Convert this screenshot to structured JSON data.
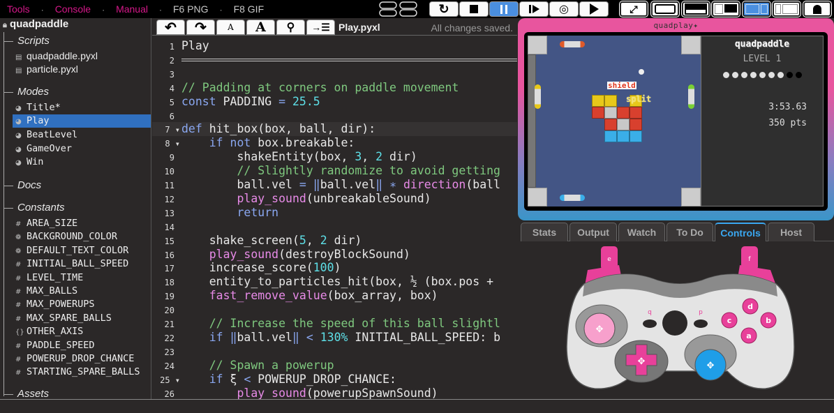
{
  "topbar": {
    "menu": [
      {
        "label": "Tools",
        "kind": "link"
      },
      {
        "label": "Console",
        "kind": "link"
      },
      {
        "label": "Manual",
        "kind": "link"
      },
      {
        "label": "F6 PNG",
        "kind": "plain"
      },
      {
        "label": "F8 GIF",
        "kind": "plain"
      }
    ],
    "separator": "·",
    "playback": [
      {
        "name": "restart",
        "icon": "restart-icon",
        "glyph": "↻"
      },
      {
        "name": "stop",
        "icon": "stop-icon",
        "glyph": "■"
      },
      {
        "name": "pause",
        "icon": "pause-icon",
        "glyph": "❚❚",
        "active": true
      },
      {
        "name": "step",
        "icon": "step-icon",
        "glyph": "❙▶"
      },
      {
        "name": "slow",
        "icon": "slow-motion-icon",
        "glyph": "◎"
      },
      {
        "name": "play",
        "icon": "play-icon",
        "glyph": "▶"
      }
    ],
    "views": [
      {
        "name": "maximal",
        "icon": "maximize-icon"
      },
      {
        "name": "emulator",
        "icon": "emulator-view-icon"
      },
      {
        "name": "test",
        "icon": "test-view-icon"
      },
      {
        "name": "wide",
        "icon": "wide-view-icon"
      },
      {
        "name": "editor",
        "icon": "editor-view-icon",
        "active": true
      },
      {
        "name": "ide",
        "icon": "ide-view-icon"
      },
      {
        "name": "ghost",
        "icon": "ghost-view-icon"
      }
    ]
  },
  "sidebar": {
    "project": "quadpaddle",
    "sections": {
      "scripts": "Scripts",
      "modes": "Modes",
      "docs": "Docs",
      "constants": "Constants",
      "assets": "Assets"
    },
    "scripts": [
      "quadpaddle.pyxl",
      "particle.pyxl"
    ],
    "modes": [
      {
        "label": "Title*",
        "selected": false
      },
      {
        "label": "Play",
        "selected": true
      },
      {
        "label": "BeatLevel",
        "selected": false
      },
      {
        "label": "GameOver",
        "selected": false
      },
      {
        "label": "Win",
        "selected": false
      }
    ],
    "constants": [
      {
        "label": "AREA_SIZE",
        "type": "#"
      },
      {
        "label": "BACKGROUND_COLOR",
        "type": "color"
      },
      {
        "label": "DEFAULT_TEXT_COLOR",
        "type": "color"
      },
      {
        "label": "INITIAL_BALL_SPEED",
        "type": "#"
      },
      {
        "label": "LEVEL_TIME",
        "type": "#"
      },
      {
        "label": "MAX_BALLS",
        "type": "#"
      },
      {
        "label": "MAX_POWERUPS",
        "type": "#"
      },
      {
        "label": "MAX_SPARE_BALLS",
        "type": "#"
      },
      {
        "label": "OTHER_AXIS",
        "type": "{}"
      },
      {
        "label": "PADDLE_SPEED",
        "type": "#"
      },
      {
        "label": "POWERUP_DROP_CHANCE",
        "type": "#"
      },
      {
        "label": "STARTING_SPARE_BALLS",
        "type": "#"
      }
    ]
  },
  "editor": {
    "toolbar": [
      {
        "name": "undo",
        "glyph": "↶"
      },
      {
        "name": "redo",
        "glyph": "↷"
      },
      {
        "name": "font-smaller",
        "glyph": "A"
      },
      {
        "name": "font-larger",
        "glyph": "A"
      },
      {
        "name": "find",
        "glyph": "⚲"
      },
      {
        "name": "indent",
        "glyph": "→☰"
      }
    ],
    "filename": "Play.pyxl",
    "status": "All changes saved.",
    "current_line": 7,
    "lines": [
      [
        [
          "t",
          "Play"
        ]
      ],
      [
        [
          "rule",
          ""
        ]
      ],
      [],
      [
        [
          "cm",
          "// Padding at corners on paddle movement"
        ]
      ],
      [
        [
          "kw",
          "const"
        ],
        [
          "t",
          " PADDING "
        ],
        [
          "op",
          "="
        ],
        [
          "t",
          " "
        ],
        [
          "nm",
          "25.5"
        ]
      ],
      [],
      [
        [
          "kw",
          "def"
        ],
        [
          "t",
          " hit_box(box, ball, dir):"
        ]
      ],
      [
        [
          "t",
          "    "
        ],
        [
          "kw",
          "if not"
        ],
        [
          "t",
          " box.breakable:"
        ]
      ],
      [
        [
          "t",
          "        shakeEntity(box, "
        ],
        [
          "nm",
          "3"
        ],
        [
          "t",
          ", "
        ],
        [
          "nm",
          "2"
        ],
        [
          "t",
          " dir)"
        ]
      ],
      [
        [
          "t",
          "        "
        ],
        [
          "cm",
          "// Slightly randomize to avoid getting"
        ]
      ],
      [
        [
          "t",
          "        ball.vel "
        ],
        [
          "op",
          "="
        ],
        [
          "t",
          " "
        ],
        [
          "op",
          "‖"
        ],
        [
          "t",
          "ball.vel"
        ],
        [
          "op",
          "‖"
        ],
        [
          "t",
          " "
        ],
        [
          "op",
          "∗"
        ],
        [
          "t",
          " "
        ],
        [
          "fn",
          "direction"
        ],
        [
          "t",
          "(ball"
        ]
      ],
      [
        [
          "t",
          "        "
        ],
        [
          "fn",
          "play_sound"
        ],
        [
          "t",
          "(unbreakableSound)"
        ]
      ],
      [
        [
          "t",
          "        "
        ],
        [
          "kw",
          "return"
        ]
      ],
      [],
      [
        [
          "t",
          "    shake_screen("
        ],
        [
          "nm",
          "5"
        ],
        [
          "t",
          ", "
        ],
        [
          "nm",
          "2"
        ],
        [
          "t",
          " dir)"
        ]
      ],
      [
        [
          "t",
          "    "
        ],
        [
          "fn",
          "play_sound"
        ],
        [
          "t",
          "(destroyBlockSound)"
        ]
      ],
      [
        [
          "t",
          "    increase_score("
        ],
        [
          "nm",
          "100"
        ],
        [
          "t",
          ")"
        ]
      ],
      [
        [
          "t",
          "    entity_to_particles_hit(box, ½ (box.pos + "
        ]
      ],
      [
        [
          "t",
          "    "
        ],
        [
          "fn",
          "fast_remove_value"
        ],
        [
          "t",
          "(box_array, box)"
        ]
      ],
      [],
      [
        [
          "t",
          "    "
        ],
        [
          "cm",
          "// Increase the speed of this ball slightl"
        ]
      ],
      [
        [
          "t",
          "    "
        ],
        [
          "kw",
          "if"
        ],
        [
          "t",
          " "
        ],
        [
          "op",
          "‖"
        ],
        [
          "t",
          "ball.vel"
        ],
        [
          "op",
          "‖"
        ],
        [
          "t",
          " "
        ],
        [
          "op",
          "<"
        ],
        [
          "t",
          " "
        ],
        [
          "nm",
          "130%"
        ],
        [
          "t",
          " INITIAL_BALL_SPEED: b"
        ]
      ],
      [],
      [
        [
          "t",
          "    "
        ],
        [
          "cm",
          "// Spawn a powerup"
        ]
      ],
      [
        [
          "t",
          "    "
        ],
        [
          "kw",
          "if"
        ],
        [
          "t",
          " ξ "
        ],
        [
          "op",
          "<"
        ],
        [
          "t",
          " POWERUP_DROP_CHANCE:"
        ]
      ],
      [
        [
          "t",
          "        "
        ],
        [
          "fn",
          "play_sound"
        ],
        [
          "t",
          "(powerupSpawnSound)"
        ]
      ]
    ],
    "fold_lines": [
      7,
      8,
      25
    ]
  },
  "emulator": {
    "brand": "quadplay✦",
    "hud": {
      "title": "quadpaddle",
      "level": "LEVEL 1",
      "lives_total": 9,
      "lives_remaining": 7,
      "time": "3:53.63",
      "score": "350 pts"
    },
    "game": {
      "powerup_labels": [
        "shield",
        "split"
      ],
      "colors": {
        "background": "#435585",
        "yellow": "#e8c81a",
        "red": "#d8402e",
        "gray": "#c8c8c8",
        "blue": "#3aaee8"
      }
    }
  },
  "debug_tabs": [
    {
      "label": "Stats",
      "active": false
    },
    {
      "label": "Output",
      "active": false
    },
    {
      "label": "Watch",
      "active": false
    },
    {
      "label": "To Do",
      "active": false
    },
    {
      "label": "Controls",
      "active": true
    },
    {
      "label": "Host",
      "active": false
    }
  ],
  "controller": {
    "buttons": [
      "a",
      "b",
      "c",
      "d",
      "e",
      "f",
      "p",
      "q"
    ],
    "colors": {
      "accent": "#e8409a",
      "dpad2": "#1f9ee8",
      "body": "#e6e6e6"
    }
  },
  "theme": {
    "link": "#d6188a",
    "selection": "#3070c0",
    "active_tab": "#3aa7f0"
  }
}
